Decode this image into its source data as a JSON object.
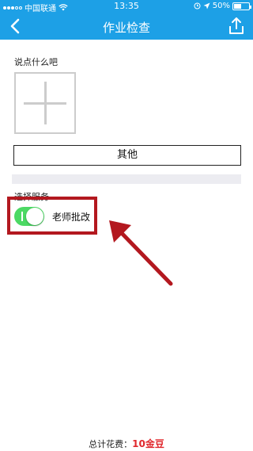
{
  "status_bar": {
    "carrier": "中国联通",
    "time": "13:35",
    "battery_text": "50%",
    "battery_level": 0.5
  },
  "nav": {
    "title": "作业检查"
  },
  "main": {
    "prompt_label": "说点什么吧",
    "other_button": "其他",
    "service_section_label": "选择服务",
    "service_option_label": "老师批改",
    "service_toggle_on": true
  },
  "footer": {
    "total_label": "总计花费：",
    "total_value": "10金豆"
  },
  "colors": {
    "header": "#1da0e6",
    "toggle_on": "#4cd964",
    "annotation": "#b3181f",
    "price": "#e0292e"
  }
}
